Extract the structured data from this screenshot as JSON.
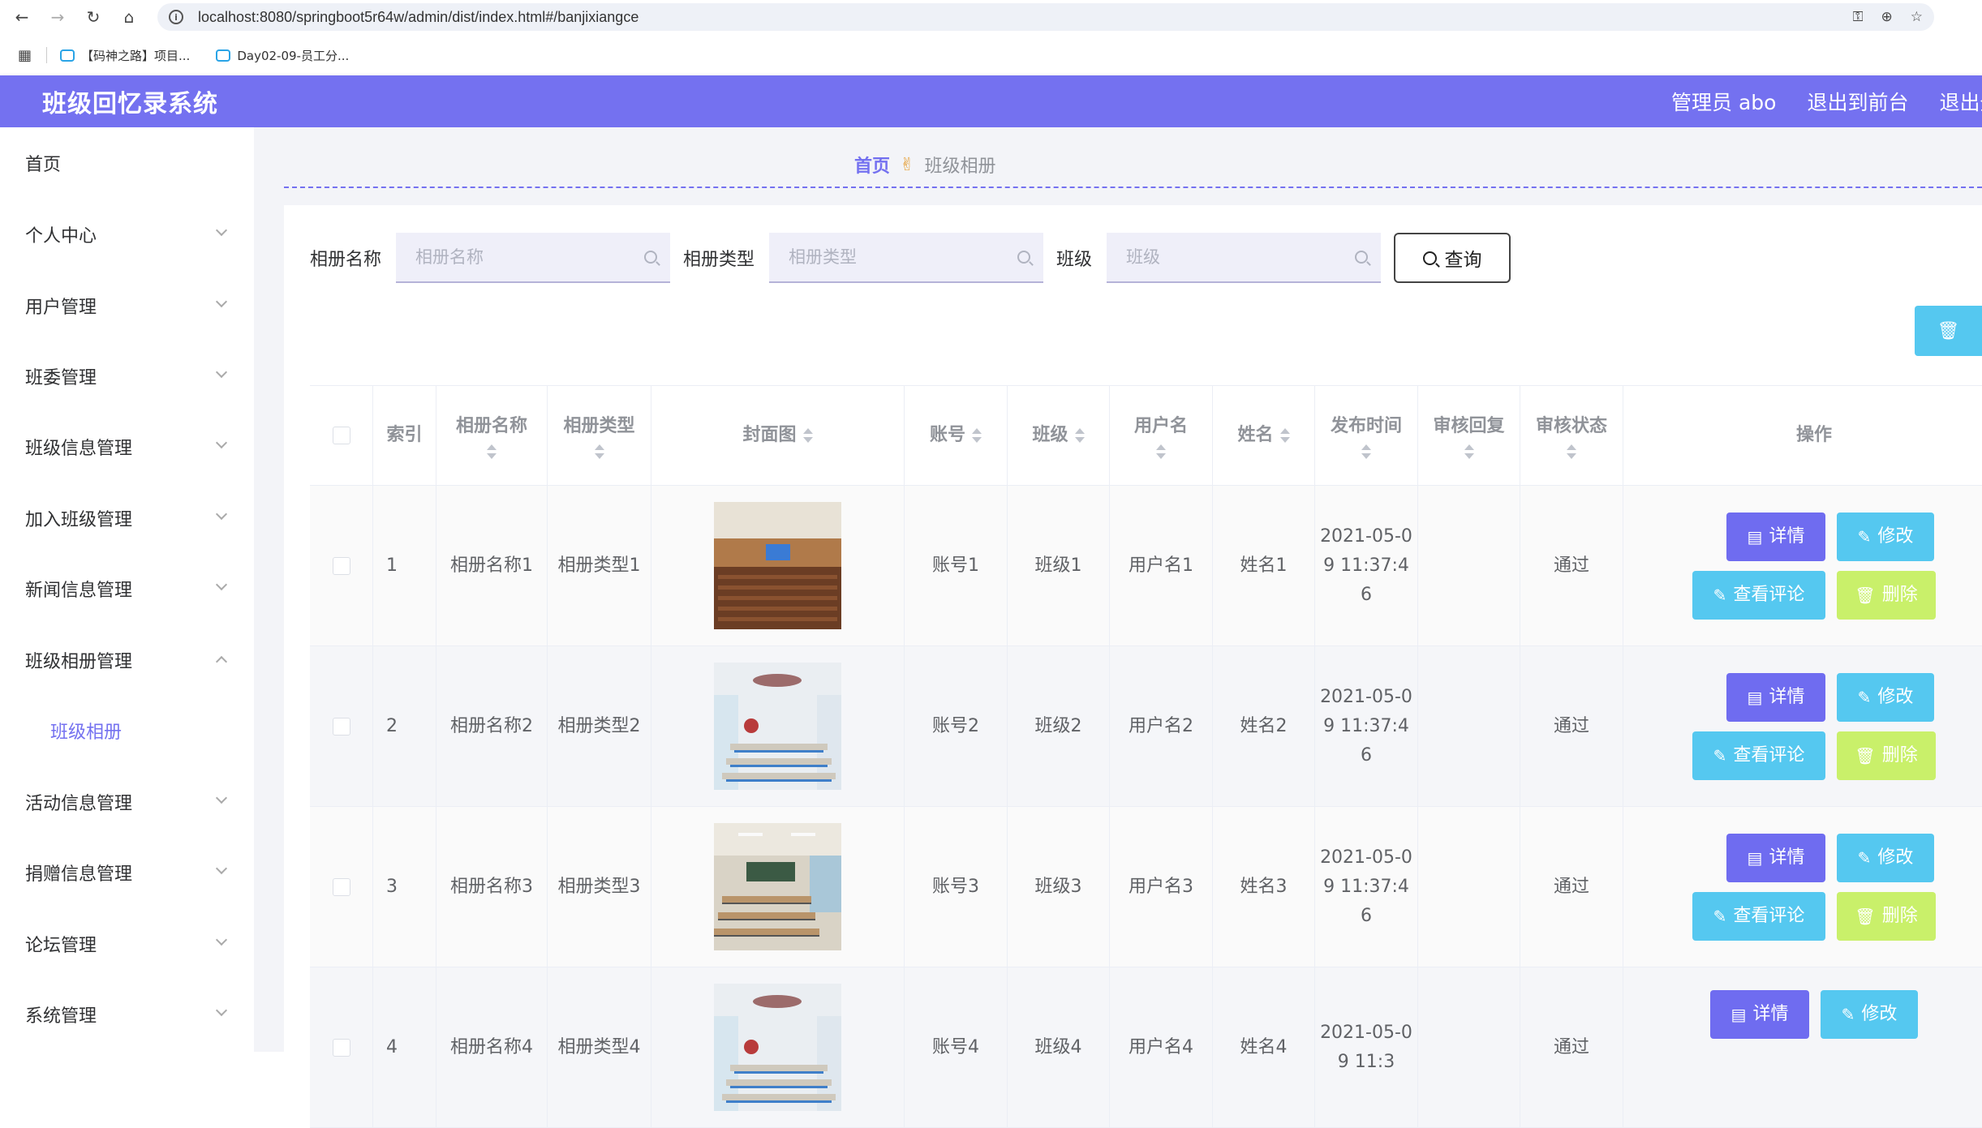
{
  "browser": {
    "url": "localhost:8080/springboot5r64w/admin/dist/index.html#/banjixiangce",
    "bookmarks": [
      "【码神之路】项目...",
      "Day02-09-员工分..."
    ]
  },
  "header": {
    "title": "班级回忆录系统",
    "user": "管理员 abo",
    "to_front": "退出到前台",
    "logout": "退出登录"
  },
  "sidebar": {
    "items": [
      {
        "label": "首页"
      },
      {
        "label": "个人中心"
      },
      {
        "label": "用户管理"
      },
      {
        "label": "班委管理"
      },
      {
        "label": "班级信息管理"
      },
      {
        "label": "加入班级管理"
      },
      {
        "label": "新闻信息管理"
      },
      {
        "label": "班级相册管理"
      },
      {
        "label": "活动信息管理"
      },
      {
        "label": "捐赠信息管理"
      },
      {
        "label": "论坛管理"
      },
      {
        "label": "系统管理"
      }
    ],
    "sub_item": "班级相册"
  },
  "breadcrumb": {
    "home": "首页",
    "current": "班级相册"
  },
  "search": {
    "fields": [
      {
        "label": "相册名称",
        "placeholder": "相册名称"
      },
      {
        "label": "相册类型",
        "placeholder": "相册类型"
      },
      {
        "label": "班级",
        "placeholder": "班级"
      }
    ],
    "query_label": "查询"
  },
  "table": {
    "headers": {
      "index": "索引",
      "name": "相册名称",
      "type": "相册类型",
      "cover": "封面图",
      "account": "账号",
      "class": "班级",
      "username": "用户名",
      "realname": "姓名",
      "time": "发布时间",
      "reply": "审核回复",
      "status": "审核状态",
      "ops": "操作"
    },
    "ops": {
      "detail": "详情",
      "edit": "修改",
      "comment": "查看评论",
      "delete": "删除"
    },
    "rows": [
      {
        "index": "1",
        "name": "相册名称1",
        "type": "相册类型1",
        "account": "账号1",
        "class": "班级1",
        "username": "用户名1",
        "realname": "姓名1",
        "time": "2021-05-09 11:37:46",
        "reply": "",
        "status": "通过"
      },
      {
        "index": "2",
        "name": "相册名称2",
        "type": "相册类型2",
        "account": "账号2",
        "class": "班级2",
        "username": "用户名2",
        "realname": "姓名2",
        "time": "2021-05-09 11:37:46",
        "reply": "",
        "status": "通过"
      },
      {
        "index": "3",
        "name": "相册名称3",
        "type": "相册类型3",
        "account": "账号3",
        "class": "班级3",
        "username": "用户名3",
        "realname": "姓名3",
        "time": "2021-05-09 11:37:46",
        "reply": "",
        "status": "通过"
      },
      {
        "index": "4",
        "name": "相册名称4",
        "type": "相册类型4",
        "account": "账号4",
        "class": "班级4",
        "username": "用户名4",
        "realname": "姓名4",
        "time": "2021-05-09 11:3",
        "reply": "",
        "status": "通过"
      }
    ]
  }
}
